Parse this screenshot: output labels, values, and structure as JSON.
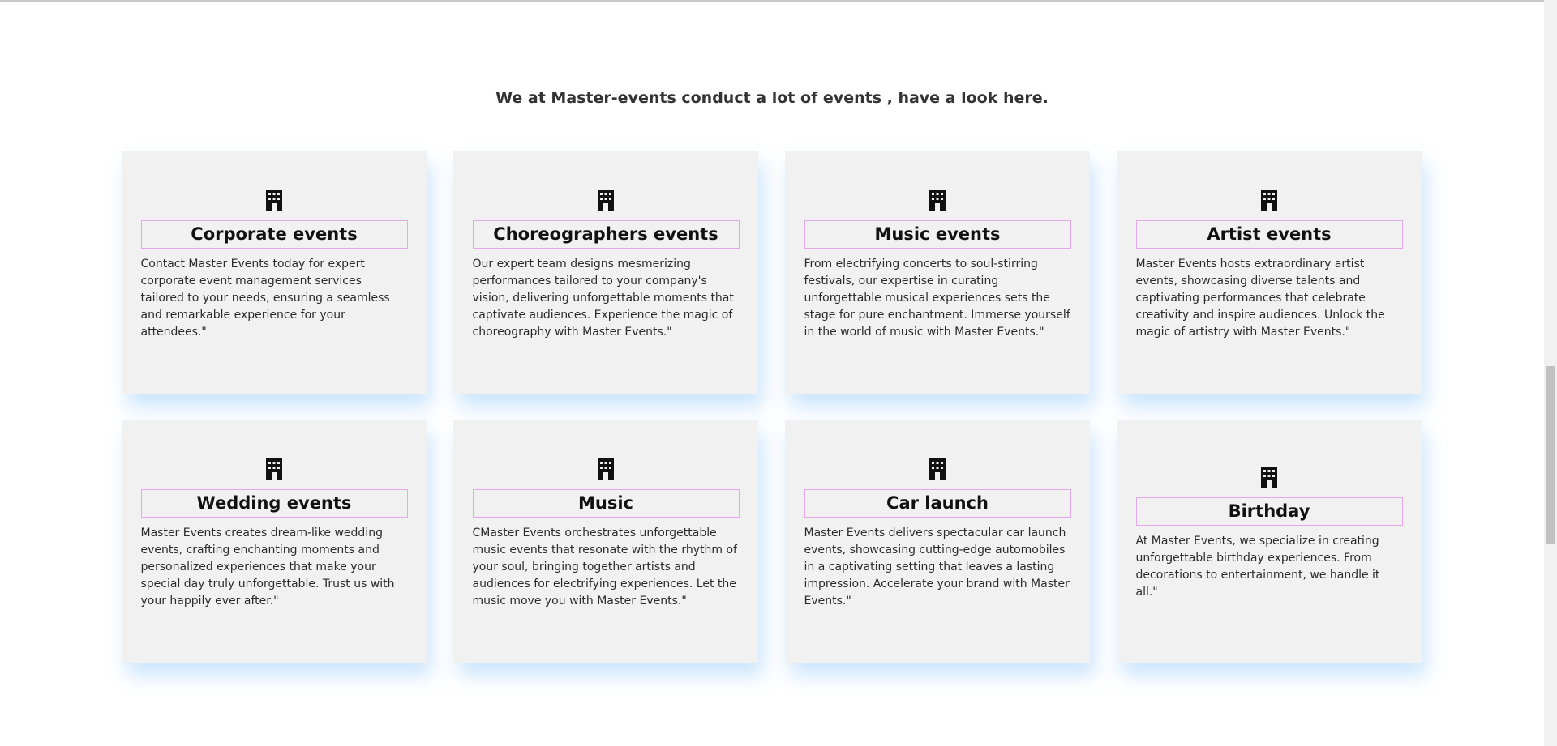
{
  "section": {
    "title": "We at Master-events conduct a lot of events , have a look here."
  },
  "cards": [
    {
      "icon": "building-icon",
      "title": "Corporate events",
      "description": "Contact Master Events today for expert corporate event management services tailored to your needs, ensuring a seamless and remarkable experience for your attendees.\""
    },
    {
      "icon": "building-icon",
      "title": "Choreographers events",
      "description": "Our expert team designs mesmerizing performances tailored to your company's vision, delivering unforgettable moments that captivate audiences. Experience the magic of choreography with Master Events.\""
    },
    {
      "icon": "building-icon",
      "title": "Music events",
      "description": "From electrifying concerts to soul-stirring festivals, our expertise in curating unforgettable musical experiences sets the stage for pure enchantment. Immerse yourself in the world of music with Master Events.\""
    },
    {
      "icon": "building-icon",
      "title": "Artist events",
      "description": "Master Events hosts extraordinary artist events, showcasing diverse talents and captivating performances that celebrate creativity and inspire audiences. Unlock the magic of artistry with Master Events.\""
    },
    {
      "icon": "building-icon",
      "title": "Wedding events",
      "description": "Master Events creates dream-like wedding events, crafting enchanting moments and personalized experiences that make your special day truly unforgettable. Trust us with your happily ever after.\""
    },
    {
      "icon": "building-icon",
      "title": "Music",
      "description": "CMaster Events orchestrates unforgettable music events that resonate with the rhythm of your soul, bringing together artists and audiences for electrifying experiences. Let the music move you with Master Events.\""
    },
    {
      "icon": "building-icon",
      "title": "Car launch",
      "description": "Master Events delivers spectacular car launch events, showcasing cutting-edge automobiles in a captivating setting that leaves a lasting impression. Accelerate your brand with Master Events.\""
    },
    {
      "icon": "building-icon",
      "title": "Birthday",
      "description": "At Master Events, we specialize in creating unforgettable birthday experiences. From decorations to entertainment, we handle it all.\""
    }
  ],
  "colors": {
    "card_background": "#f1f1f1",
    "title_border": "#e3a8e9",
    "shadow": "#6eb4f5"
  }
}
